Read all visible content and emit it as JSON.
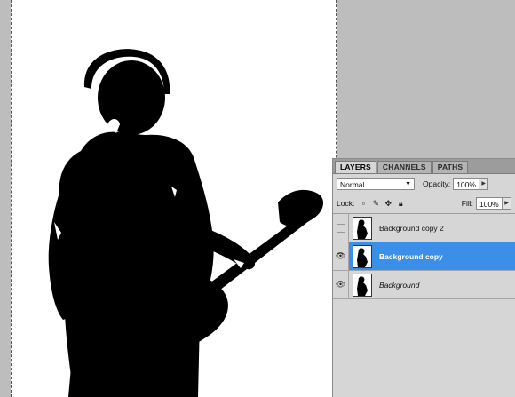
{
  "panel": {
    "tabs": [
      {
        "label": "LAYERS",
        "active": true
      },
      {
        "label": "CHANNELS",
        "active": false
      },
      {
        "label": "PATHS",
        "active": false
      }
    ],
    "blend_mode": "Normal",
    "opacity_label": "Opacity:",
    "opacity_value": "100%",
    "lock_label": "Lock:",
    "fill_label": "Fill:",
    "fill_value": "100%",
    "lock_icons": [
      "lock-transparent-pixels-icon",
      "lock-image-pixels-icon",
      "lock-position-icon",
      "lock-all-icon"
    ],
    "layers": [
      {
        "name": "Background copy 2",
        "visible": false,
        "selected": false,
        "italic": false
      },
      {
        "name": "Background copy",
        "visible": true,
        "selected": true,
        "italic": false
      },
      {
        "name": "Background",
        "visible": true,
        "selected": false,
        "italic": true
      }
    ]
  },
  "colors": {
    "selection": "#3c8fe8",
    "workspace": "#bdbdbd",
    "panel": "#d6d6d6"
  }
}
